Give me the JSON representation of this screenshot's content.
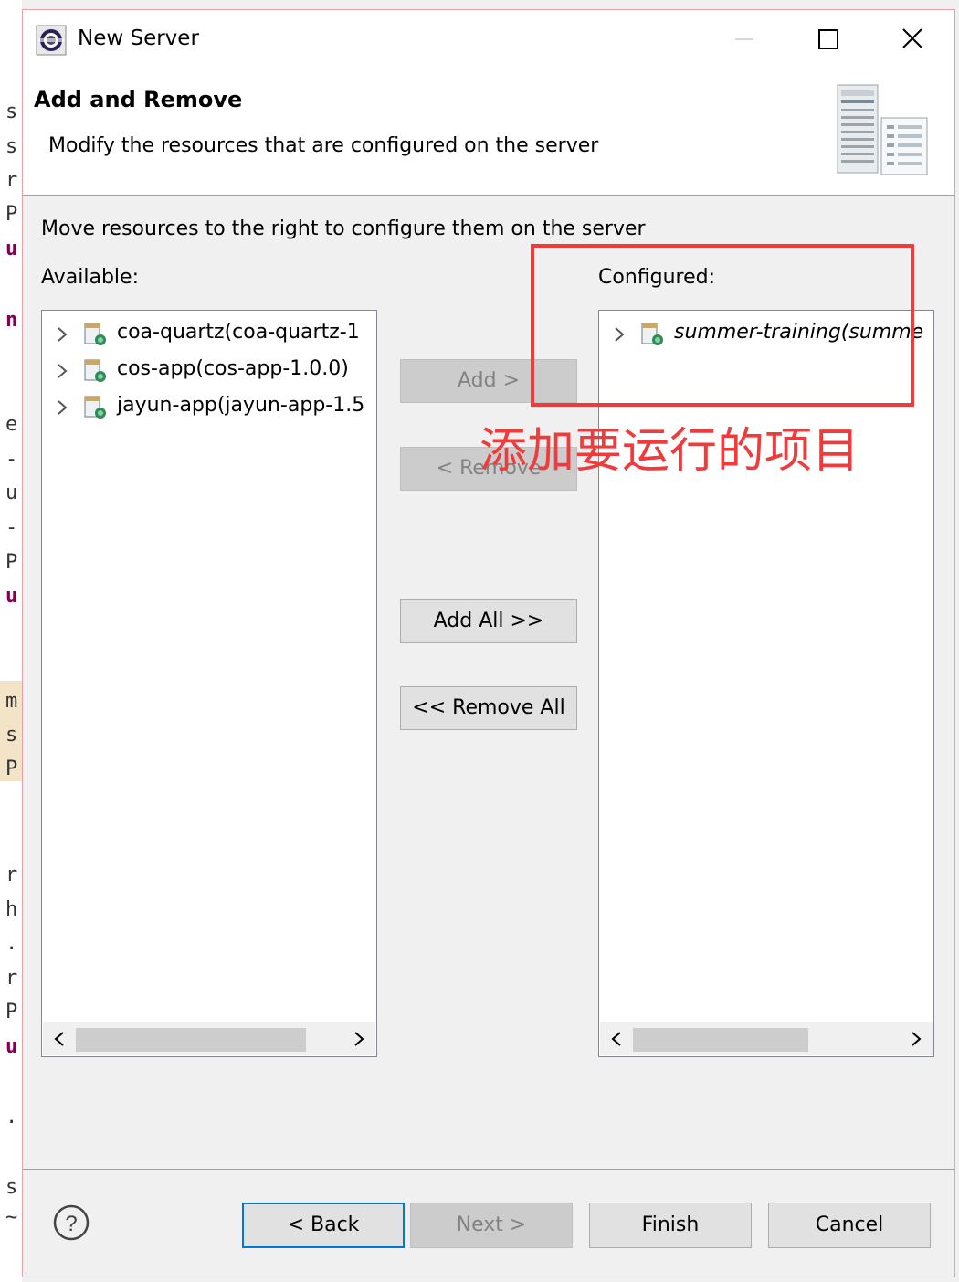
{
  "window": {
    "title": "New Server",
    "controls": [
      "minimize-icon",
      "maximize-icon",
      "close-icon"
    ]
  },
  "header": {
    "title": "Add and Remove",
    "description": "Modify the resources that are configured on the server"
  },
  "instruction": "Move resources to the right to configure them on the server",
  "available": {
    "label": "Available:",
    "items": [
      {
        "label": "coa-quartz(coa-quartz-1"
      },
      {
        "label": "cos-app(cos-app-1.0.0)"
      },
      {
        "label": "jayun-app(jayun-app-1.5"
      }
    ]
  },
  "configured": {
    "label": "Configured:",
    "items": [
      {
        "label": "summer-training(summe"
      }
    ]
  },
  "buttons": {
    "add": "Add >",
    "remove": "< Remove",
    "add_all": "Add All >>",
    "remove_all": "<< Remove All",
    "back": "< Back",
    "next": "Next >",
    "finish": "Finish",
    "cancel": "Cancel"
  },
  "annotation": {
    "text": "添加要运行的项目",
    "color": "#ef3b3b"
  },
  "background_editor": {
    "fragments": [
      "s",
      "s",
      "r",
      "P",
      "u",
      "n",
      "e",
      "-",
      "u",
      "-",
      "P",
      "u",
      "m",
      "s",
      "P",
      "r",
      "h",
      ".",
      "r",
      "P",
      "u",
      ".",
      "s",
      "~"
    ]
  },
  "colors": {
    "focus": "#0078d7",
    "button_face": "#e1e1e1",
    "disabled_text": "#838383"
  }
}
